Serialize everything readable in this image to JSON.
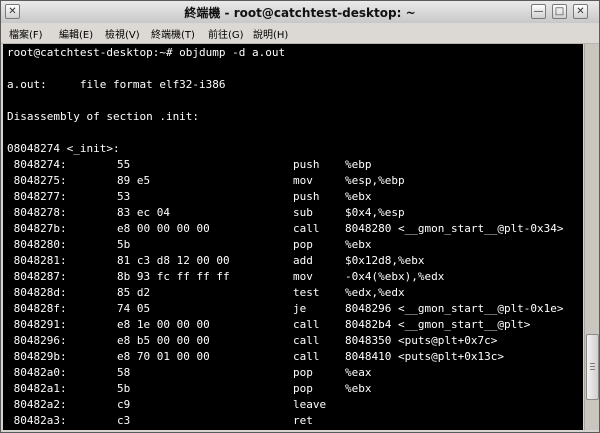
{
  "window": {
    "title": "終端機 - root@catchtest-desktop: ~",
    "buttons": {
      "close": "✕",
      "min": "—",
      "max": "□",
      "right_close": "✕"
    }
  },
  "menubar": {
    "items": [
      {
        "label": "檔案(F)"
      },
      {
        "label": "編輯(E)"
      },
      {
        "label": "檢視(V)"
      },
      {
        "label": "終端機(T)"
      },
      {
        "label": "前往(G)"
      },
      {
        "label": "說明(H)"
      }
    ]
  },
  "terminal": {
    "prompt": "root@catchtest-desktop:~# objdump -d a.out",
    "file_format": "a.out:     file format elf32-i386",
    "section": "Disassembly of section .init:",
    "symbol": "08048274 <_init>:",
    "rows": [
      {
        "addr": " 8048274:",
        "bytes": "55",
        "op": "push",
        "args": "%ebp"
      },
      {
        "addr": " 8048275:",
        "bytes": "89 e5",
        "op": "mov",
        "args": "%esp,%ebp"
      },
      {
        "addr": " 8048277:",
        "bytes": "53",
        "op": "push",
        "args": "%ebx"
      },
      {
        "addr": " 8048278:",
        "bytes": "83 ec 04",
        "op": "sub",
        "args": "$0x4,%esp"
      },
      {
        "addr": " 804827b:",
        "bytes": "e8 00 00 00 00",
        "op": "call",
        "args": "8048280 <__gmon_start__@plt-0x34>"
      },
      {
        "addr": " 8048280:",
        "bytes": "5b",
        "op": "pop",
        "args": "%ebx"
      },
      {
        "addr": " 8048281:",
        "bytes": "81 c3 d8 12 00 00",
        "op": "add",
        "args": "$0x12d8,%ebx"
      },
      {
        "addr": " 8048287:",
        "bytes": "8b 93 fc ff ff ff",
        "op": "mov",
        "args": "-0x4(%ebx),%edx"
      },
      {
        "addr": " 804828d:",
        "bytes": "85 d2",
        "op": "test",
        "args": "%edx,%edx"
      },
      {
        "addr": " 804828f:",
        "bytes": "74 05",
        "op": "je",
        "args": "8048296 <__gmon_start__@plt-0x1e>"
      },
      {
        "addr": " 8048291:",
        "bytes": "e8 1e 00 00 00",
        "op": "call",
        "args": "80482b4 <__gmon_start__@plt>"
      },
      {
        "addr": " 8048296:",
        "bytes": "e8 b5 00 00 00",
        "op": "call",
        "args": "8048350 <puts@plt+0x7c>"
      },
      {
        "addr": " 804829b:",
        "bytes": "e8 70 01 00 00",
        "op": "call",
        "args": "8048410 <puts@plt+0x13c>"
      },
      {
        "addr": " 80482a0:",
        "bytes": "58",
        "op": "pop",
        "args": "%eax"
      },
      {
        "addr": " 80482a1:",
        "bytes": "5b",
        "op": "pop",
        "args": "%ebx"
      },
      {
        "addr": " 80482a2:",
        "bytes": "c9",
        "op": "leave",
        "args": ""
      },
      {
        "addr": " 80482a3:",
        "bytes": "c3",
        "op": "ret",
        "args": ""
      }
    ]
  }
}
